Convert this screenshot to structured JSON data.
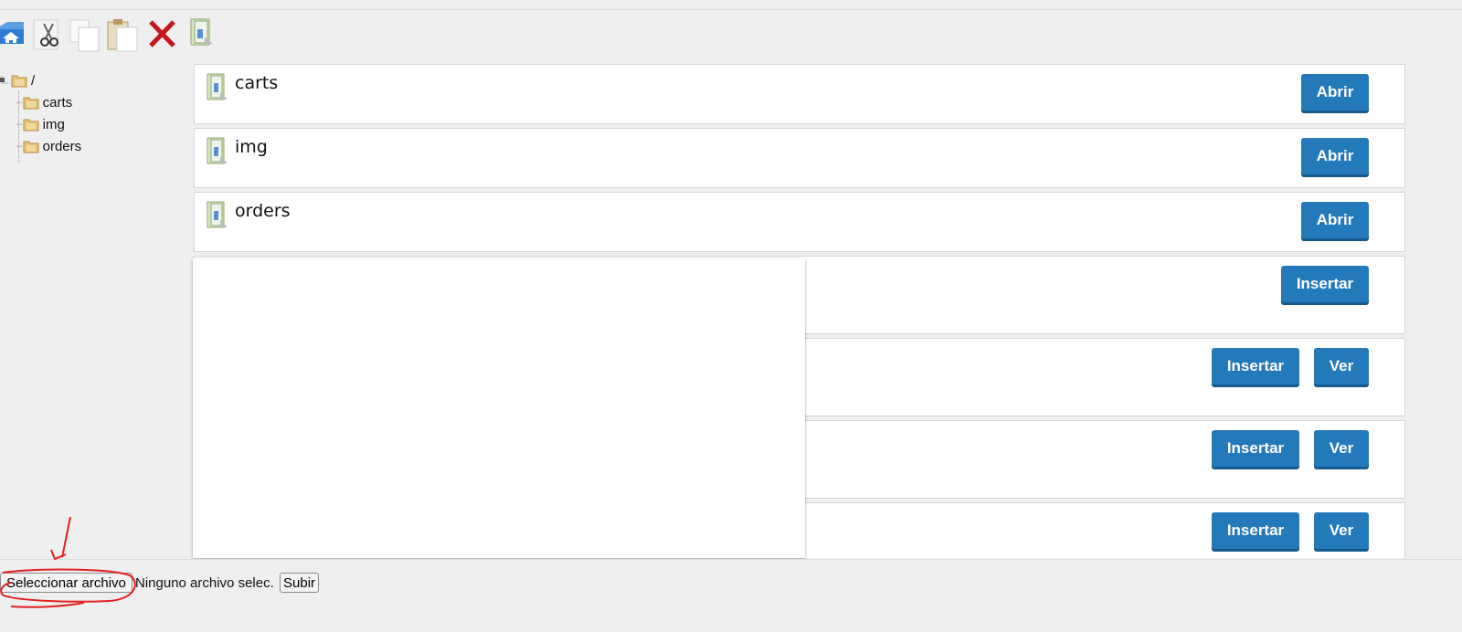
{
  "toolbar": {
    "items": [
      {
        "icon": "home-icon"
      },
      {
        "icon": "cut-icon"
      },
      {
        "icon": "copy-icon"
      },
      {
        "icon": "paste-icon"
      },
      {
        "icon": "delete-icon"
      },
      {
        "icon": "new-folder-icon"
      }
    ]
  },
  "tree": {
    "root": "/",
    "children": [
      "carts",
      "img",
      "orders"
    ]
  },
  "folders": [
    {
      "name": "carts",
      "action": "Abrir"
    },
    {
      "name": "img",
      "action": "Abrir"
    },
    {
      "name": "orders",
      "action": "Abrir"
    }
  ],
  "files": {
    "insert_label": "Insertar",
    "view_label": "Ver"
  },
  "upload": {
    "choose_label": "Seleccionar archivo",
    "no_file_text": "Ninguno archivo selec.",
    "submit_label": "Subir"
  },
  "colors": {
    "button_blue": "#2479bb",
    "delete_red": "#c4161c",
    "annotation_red": "#e32020"
  }
}
